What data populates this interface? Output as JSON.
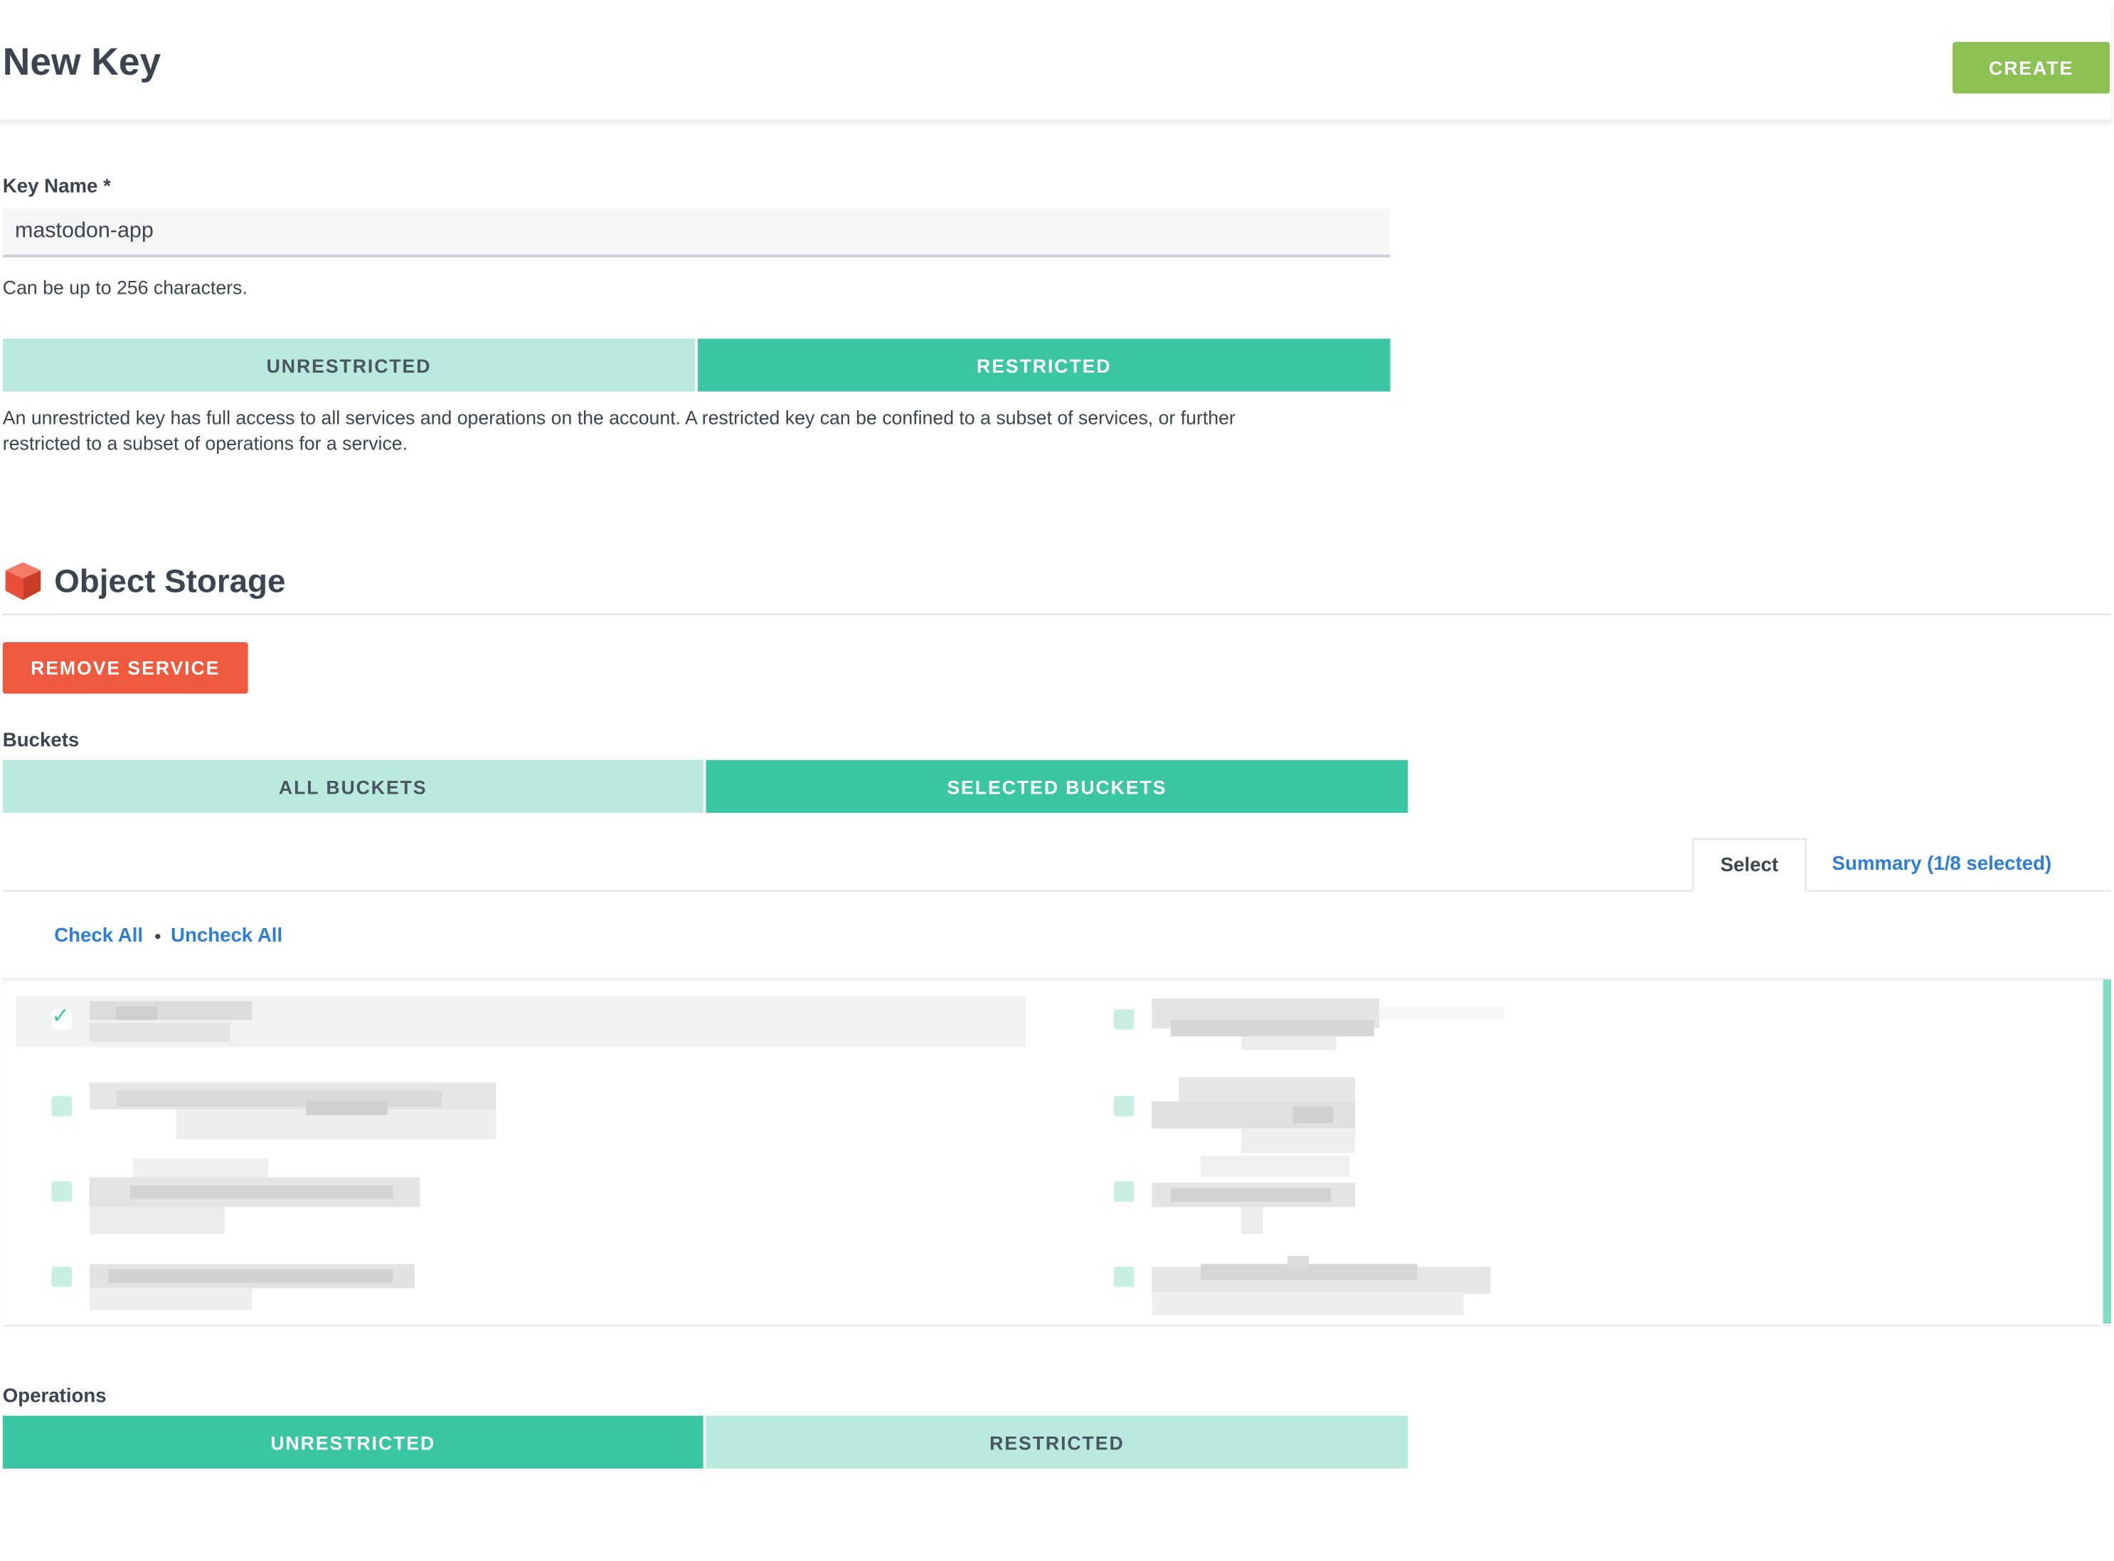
{
  "header": {
    "title": "New Key",
    "create_label": "CREATE"
  },
  "key_name": {
    "label": "Key Name *",
    "value": "mastodon-app",
    "hint": "Can be up to 256 characters."
  },
  "access": {
    "options": [
      "UNRESTRICTED",
      "RESTRICTED"
    ],
    "selected": "RESTRICTED",
    "description_line1": "An unrestricted key has full access to all services and operations on the account. A restricted key can be confined to a subset of services, or further",
    "description_line2": "restricted to a subset of operations for a service."
  },
  "service": {
    "title": "Object Storage",
    "icon": "cube-icon",
    "remove_label": "REMOVE SERVICE"
  },
  "buckets": {
    "label": "Buckets",
    "options": [
      "ALL BUCKETS",
      "SELECTED BUCKETS"
    ],
    "selected": "SELECTED BUCKETS",
    "tabs": {
      "select": "Select",
      "summary": "Summary (1/8 selected)"
    },
    "check_all": "Check All",
    "separator": "•",
    "uncheck_all": "Uncheck All",
    "items_checked": [
      true,
      false,
      false,
      false,
      false,
      false,
      false,
      false
    ]
  },
  "operations": {
    "label": "Operations",
    "options": [
      "UNRESTRICTED",
      "RESTRICTED"
    ],
    "selected": "UNRESTRICTED"
  },
  "colors": {
    "accent": "#3bc6a3",
    "accent_light": "#bae9de",
    "create": "#8dc153",
    "danger": "#ef5a3f",
    "link": "#2e7fd3"
  }
}
